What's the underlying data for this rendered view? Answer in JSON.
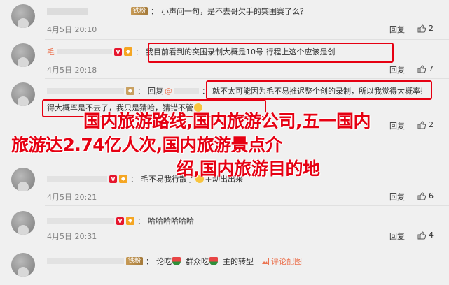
{
  "comments": [
    {
      "username": "",
      "badge": "铁粉",
      "text": "小声问一句，是不去哥欠手的突围赛了么？",
      "date": "4月5日 20:10",
      "reply_label": "回复",
      "likes": "2"
    },
    {
      "username": "毛",
      "badge_v": "V",
      "text": "我目前看到的突围录制大概是10号 行程上这个应该是创",
      "date": "4月5日 20:18",
      "reply_label": "回复",
      "likes": "7"
    },
    {
      "username": "",
      "reply_prefix": "回复",
      "reply_to": "@",
      "text": "就不太可能因为毛不易推迟整个创的录制，所以我觉得大概率是不去了。我只是猜哈，猜错不管",
      "date": "",
      "reply_label": "回复",
      "likes": "2"
    },
    {
      "username": "",
      "badge_v": "V",
      "text": "毛不易我行散了",
      "text_tail": "主动出出来",
      "date": "4月5日 20:21",
      "reply_label": "回复",
      "likes": "6"
    },
    {
      "username": "",
      "badge_v": "V",
      "text": "哈哈哈哈哈哈",
      "date": "4月5日 20:31",
      "reply_label": "回复",
      "likes": "4"
    },
    {
      "username": "",
      "badge": "铁粉",
      "text": "论吃",
      "text_mid": "群众吃",
      "text_tail": "主的转型",
      "comment_link": "评论配图",
      "date": "",
      "reply_label": "回复",
      "likes": ""
    }
  ],
  "overlay": {
    "line1": "国内旅游路线,国内旅游公司,五一国内",
    "line2": "旅游达2.74亿人次,国内旅游景点介",
    "line3": "绍,国内旅游目的地"
  },
  "colors": {
    "accent": "#eb7350",
    "highlight": "#e60012",
    "background": "#f0f0f0"
  }
}
